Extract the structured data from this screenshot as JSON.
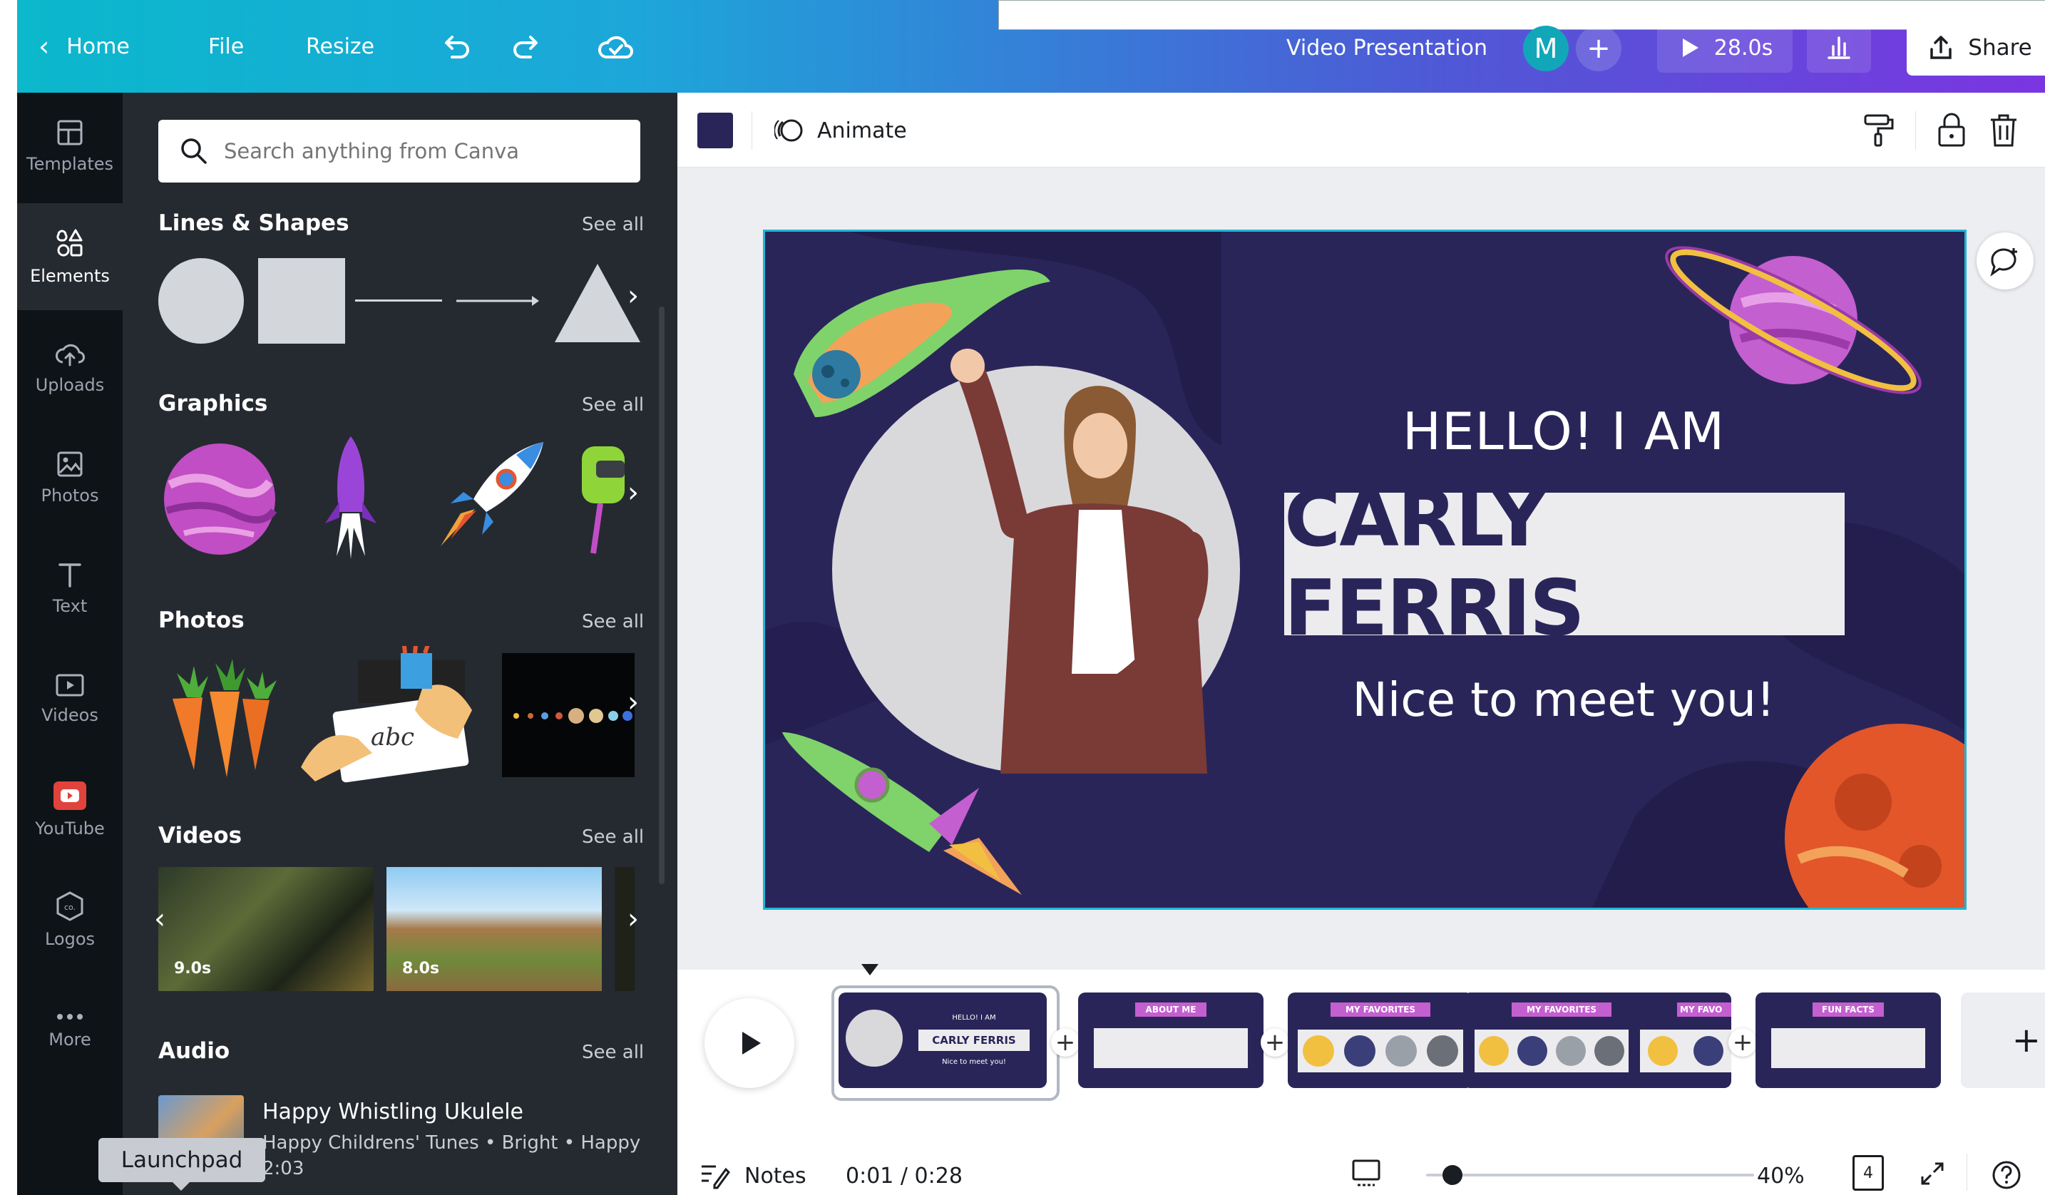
{
  "topbar": {
    "home_label": "Home",
    "file_label": "File",
    "resize_label": "Resize",
    "doc_title": "Video Presentation",
    "avatar_initial": "M",
    "duration_label": "28.0s",
    "share_label": "Share"
  },
  "rail": {
    "items": [
      {
        "label": "Templates",
        "icon": "templates-icon"
      },
      {
        "label": "Elements",
        "icon": "elements-icon"
      },
      {
        "label": "Uploads",
        "icon": "uploads-icon"
      },
      {
        "label": "Photos",
        "icon": "photos-icon"
      },
      {
        "label": "Text",
        "icon": "text-icon"
      },
      {
        "label": "Videos",
        "icon": "videos-icon"
      },
      {
        "label": "YouTube",
        "icon": "youtube-icon"
      },
      {
        "label": "Logos",
        "icon": "logos-icon"
      },
      {
        "label": "More",
        "icon": "more-icon"
      }
    ]
  },
  "panel": {
    "search_placeholder": "Search anything from Canva",
    "see_all": "See all",
    "sections": {
      "lines_shapes": "Lines & Shapes",
      "graphics": "Graphics",
      "photos": "Photos",
      "videos": "Videos",
      "audio": "Audio"
    },
    "videos": [
      {
        "duration": "9.0s"
      },
      {
        "duration": "8.0s"
      }
    ],
    "audio": {
      "title": "Happy Whistling Ukulele",
      "subtitle": "Happy Childrens' Tunes • Bright • Happy",
      "duration": "2:03"
    },
    "tooltip": "Launchpad",
    "photo_sketch_text": "abc"
  },
  "editor": {
    "animate_label": "Animate",
    "accent_color": "#2a2559"
  },
  "slide": {
    "greeting": "HELLO! I AM",
    "name": "CARLY FERRIS",
    "tagline": "Nice to meet you!"
  },
  "timeline": {
    "thumbs": [
      {
        "heading": "HELLO! I AM",
        "name": "CARLY FERRIS",
        "sub": "Nice to meet you!"
      },
      {
        "heading": "ABOUT ME"
      },
      {
        "heading": "MY FAVORITES"
      },
      {
        "heading": "MY FAVORITES"
      },
      {
        "heading": "MY FAVO"
      },
      {
        "heading": "FUN FACTS"
      }
    ]
  },
  "statusbar": {
    "notes_label": "Notes",
    "time_readout": "0:01 / 0:28",
    "zoom": "40%",
    "page_count": "4",
    "zoom_fraction": 0.05
  }
}
